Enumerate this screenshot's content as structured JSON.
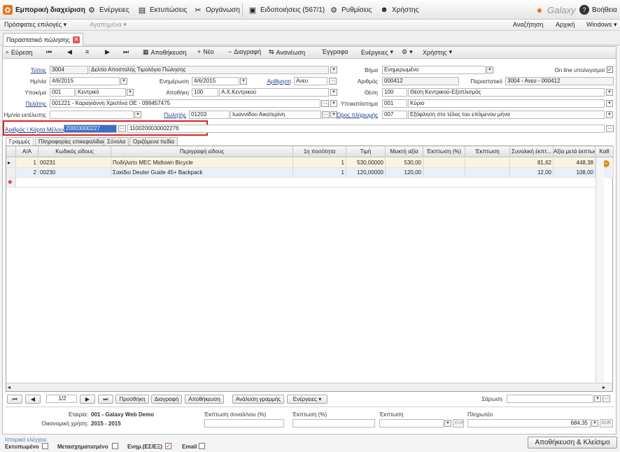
{
  "app": {
    "title": "Εμπορική διαχείριση",
    "menu": [
      "Ενέργειες",
      "Εκτυπώσεις",
      "Οργάνωση",
      "Ειδοποιήσεις (567/1)",
      "Ρυθμίσεις",
      "Χρήστης"
    ],
    "logo": "Galaxy",
    "help": "Βοήθεια"
  },
  "subbar": {
    "recent": "Πρόσφατες επιλογές",
    "favorites": "Αγαπημένα",
    "search": "Αναζήτηση",
    "home": "Αρχική",
    "windows": "Windows"
  },
  "doc_tab": "Παραστατικό πώλησης",
  "toolbar": {
    "find": "Εύρεση",
    "save": "Αποθήκευση",
    "new": "Νέο",
    "delete": "Διαγραφή",
    "refresh": "Ανανέωση",
    "docs": "Έγγραφα",
    "actions": "Ενέργειες",
    "user": "Χρήστης"
  },
  "form": {
    "type_label": "Τύπος",
    "type_code": "3004",
    "type_desc": "Δελτίο Αποστολής Τιμολόγιο Πώλησης",
    "date_label": "Ημ/νία",
    "date": "4/6/2015",
    "update_label": "Ενημέρωση",
    "update_date": "4/6/2015",
    "numbering_label": "Αρίθμηση",
    "numbering": "Ανευ",
    "branch_label": "Υποκ/μα",
    "branch_code": "001",
    "branch_desc": "Κεντρικό",
    "warehouse_label": "Αποθήκη",
    "warehouse_code": "100",
    "warehouse_desc": "Α.Χ.Κεντρικού",
    "customer_label": "Πελάτης",
    "customer": "001221 - Καραγιάννη Χριστίνα ΟΕ - 099457475",
    "exec_date_label": "Ημ/νία εκτέλεσης",
    "exec_date": "",
    "seller_label": "Πωλητής",
    "seller_code": "01203",
    "seller_name": "Ιωαννίδου Αικατερίνη",
    "step_label": "Βήμα",
    "step": "Ενημερωμένο",
    "online_label": "On line υπολογισμοί",
    "number_label": "Αριθμός",
    "number": "000412",
    "doc_label": "Παραστατικό",
    "doc": "3004 - Ανευ - 000412",
    "position_label": "Θέση",
    "position_code": "100",
    "position_desc": "Θέση Κεντρικού-Εξοπλισμός",
    "store_label": "Υποκατάστημα",
    "store_code": "001",
    "store_desc": "Κύριο",
    "payment_label": "Όρος πληρωμής",
    "payment_code": "007",
    "payment_desc": "Εξόφληση στο τέλος του επόμενου μήνα",
    "member_label": "Αριθμός \\ Κάρτα Μέλους",
    "member_no": "20003000227",
    "member_card": "1100200030002276"
  },
  "grid_tabs": [
    "Γραμμές",
    "Πληροφορίες επικεφαλίδας",
    "Σύνολα",
    "Οριζόμενα πεδία"
  ],
  "grid": {
    "columns": [
      "Α/Α",
      "Κωδικός είδους",
      "Περιγραφή είδους",
      "1η ποσότητα",
      "Τιμή",
      "Μεικτή αξία",
      "Έκπτωση (%)",
      "Έκπτωση",
      "Συνολική έκπτ...",
      "Αξία μετά έκπτωσης",
      "Καθ"
    ],
    "rows": [
      {
        "aa": "1",
        "code": "00231",
        "desc": "Ποδήλατο MEC Midtown Bicycle",
        "qty": "1",
        "price": "530,00000",
        "gross": "530,00",
        "disc_pct": "",
        "disc": "",
        "total_disc": "81,62",
        "net": "448,38"
      },
      {
        "aa": "2",
        "code": "00230",
        "desc": "Σακίδιο Deuter Guide 45+ Backpack",
        "qty": "1",
        "price": "120,00000",
        "gross": "120,00",
        "disc_pct": "",
        "disc": "",
        "total_disc": "12,00",
        "net": "108,00"
      }
    ]
  },
  "pager": {
    "page": "1/2",
    "buttons": [
      "Προσθήκη",
      "Διαγραφή",
      "Αποθήκευση",
      "Ανάλυση γραμμής",
      "Ενέργειες"
    ],
    "scan_label": "Σάρωση"
  },
  "footer": {
    "company_label": "Εταιρία:",
    "company": "001 - Galaxy Web Demo",
    "year_label": "Οικονομική χρήση:",
    "year": "2015 - 2015",
    "trans_disc_label": "Έκπτωση συναλ/νου (%)",
    "disc_pct_label": "Έκπτωση (%)",
    "disc_label": "Έκπτωση",
    "pay_label": "Πληρωτέο",
    "pay_value": "684,35",
    "currency": "EUR",
    "history": "Ιστορικό ελέγχου",
    "printed": "Εκτυπωμένο",
    "transformed": "Μετασχηματισμένο",
    "updated": "Ενημ.(ΕΣ/ΕΞ)",
    "email": "Email",
    "save_close": "Αποθήκευση & Κλείσιμο"
  },
  "colors": {
    "accent": "#e08a2a",
    "highlight": "#e02020",
    "selection": "#3a6fc4"
  }
}
